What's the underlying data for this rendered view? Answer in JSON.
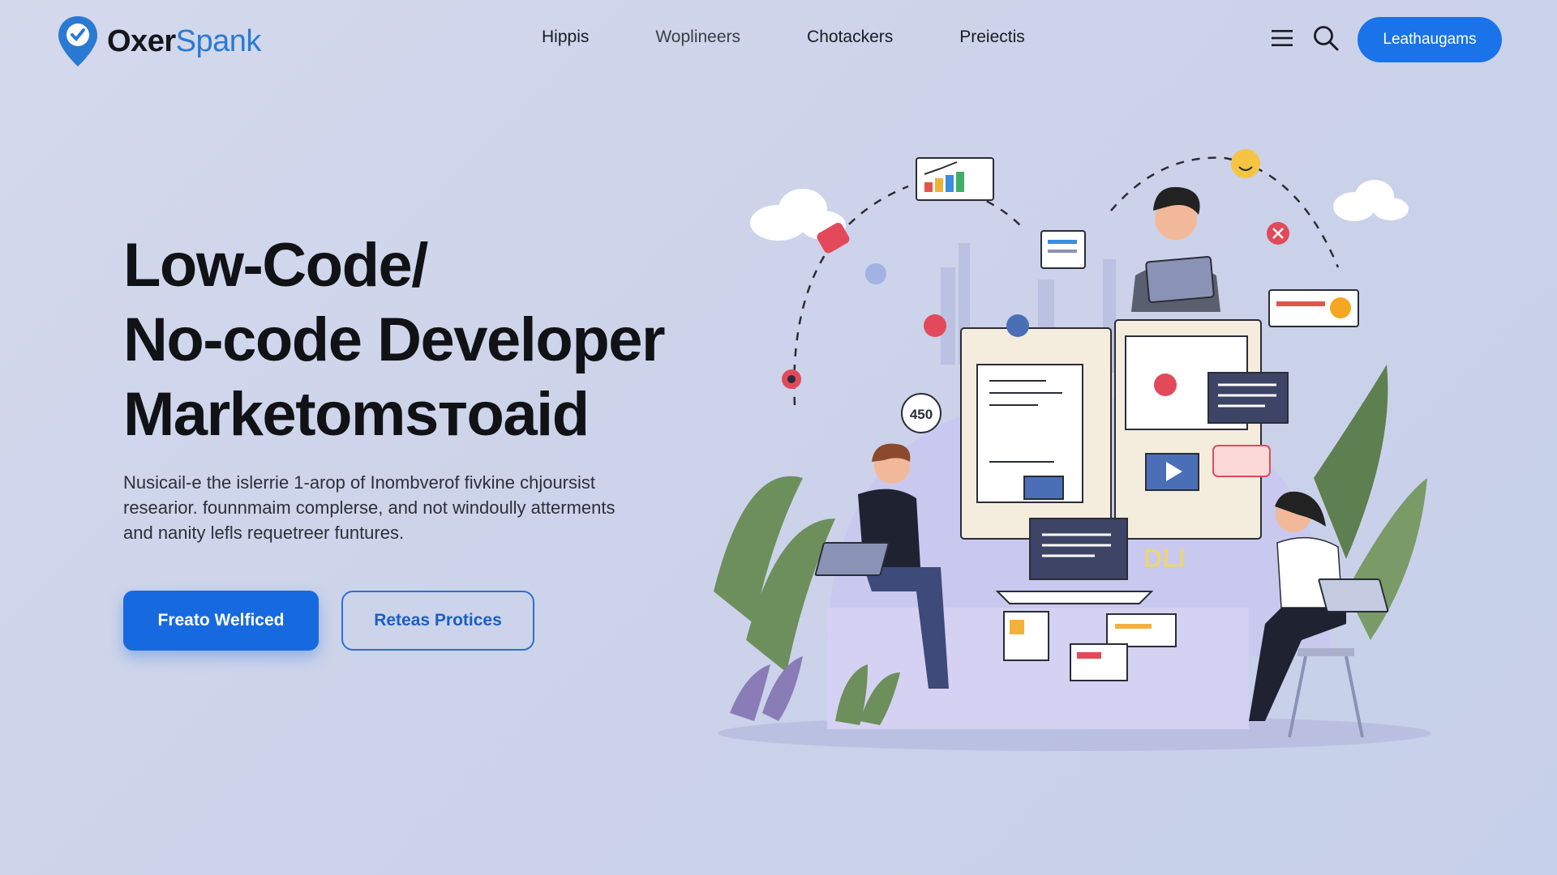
{
  "header": {
    "logo": {
      "part1": "Oxer",
      "part2": "Spank",
      "icon": "map-pin-icon"
    },
    "nav": [
      {
        "label": "Hippis"
      },
      {
        "label": "Woplineers"
      },
      {
        "label": "Chotackers"
      },
      {
        "label": "Preiectis"
      }
    ],
    "menu_icon": "hamburger-menu-icon",
    "search_icon": "search-icon",
    "cta_label": "Leathaugams"
  },
  "hero": {
    "title_lines": [
      "Low-Code/",
      "No-code Developer",
      "Marketomsтoaid"
    ],
    "description_lines": [
      "Nusicail-e the islerrie 1-arop of Inombverof fivkine chjoursist",
      "researior. founnmaim complerse, and not windoully atterments",
      "and nanity lefls requetreer funtures."
    ],
    "primary_button": "Freato Welficed",
    "secondary_button": "Reteas Protices"
  },
  "illustration": {
    "labels": [
      "450",
      "DLI"
    ]
  },
  "colors": {
    "accent": "#1a73e8",
    "logo_blue": "#2a7ad3",
    "background": "#ccd3ea"
  }
}
